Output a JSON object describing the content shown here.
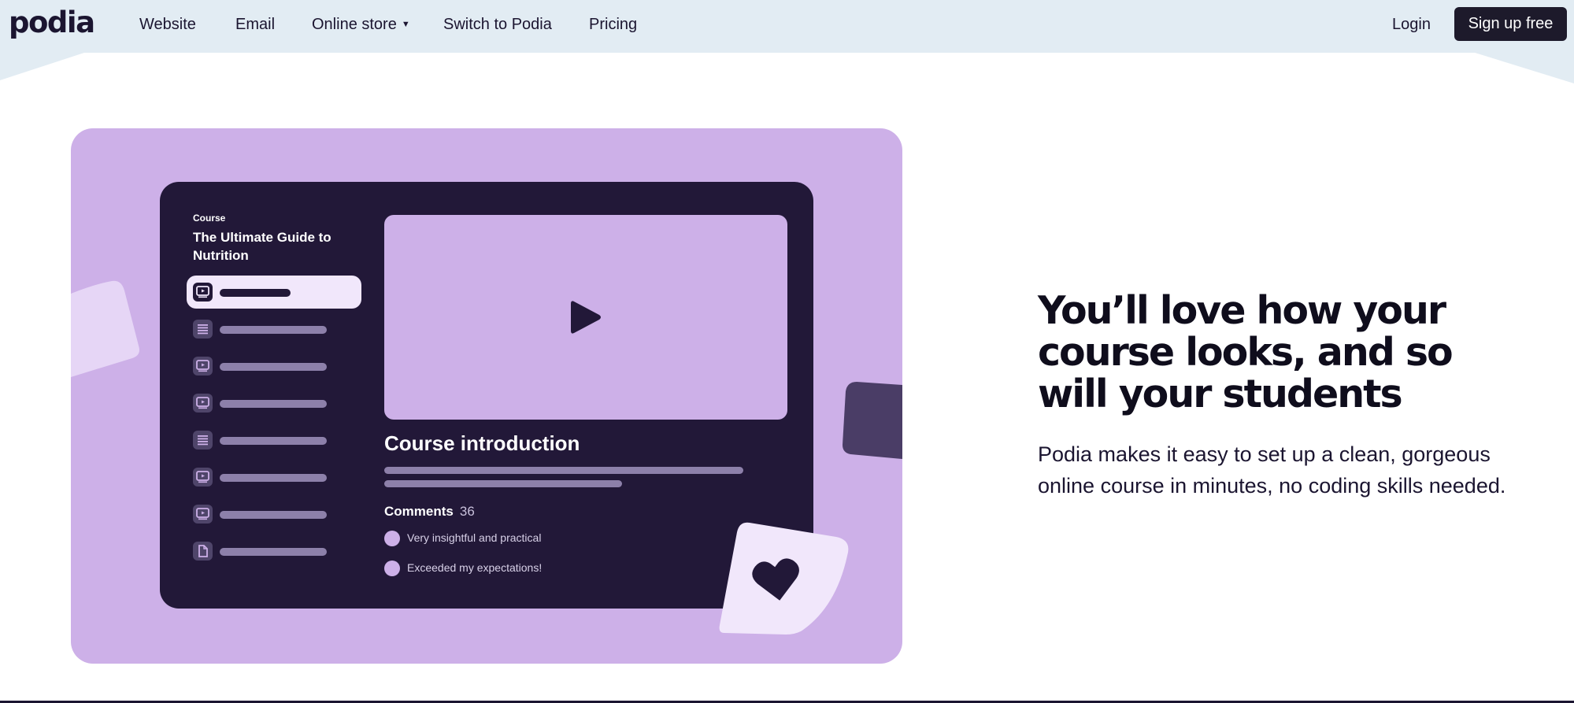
{
  "nav": {
    "logo": "podia",
    "links": [
      "Website",
      "Email",
      "Online store",
      "Switch to Podia",
      "Pricing"
    ],
    "login": "Login",
    "signup": "Sign up free"
  },
  "mockup": {
    "kicker": "Course",
    "course_title": "The Ultimate Guide to Nutrition",
    "lesson_icons": [
      "video-lesson-icon",
      "text-lesson-icon",
      "video-lesson-icon",
      "video-lesson-icon",
      "text-lesson-icon",
      "video-lesson-icon",
      "video-lesson-icon",
      "document-lesson-icon"
    ],
    "intro_title": "Course introduction",
    "comments_label": "Comments",
    "comments_count": "36",
    "comments": [
      "Very insightful and practical",
      "Exceeded my expectations!"
    ]
  },
  "hero": {
    "headline_lines": [
      "You’ll love how your",
      "course looks, and so",
      "will your students"
    ],
    "subtext": "Podia makes it easy to set up a clean, gorgeous online course in minutes, no coding skills needed."
  },
  "colors": {
    "nav_bg": "#e2ecf3",
    "card_bg": "#cdb0e8",
    "screen_bg": "#221838",
    "button_bg": "#1d1a2b",
    "accent_light": "#f1e7fb"
  }
}
